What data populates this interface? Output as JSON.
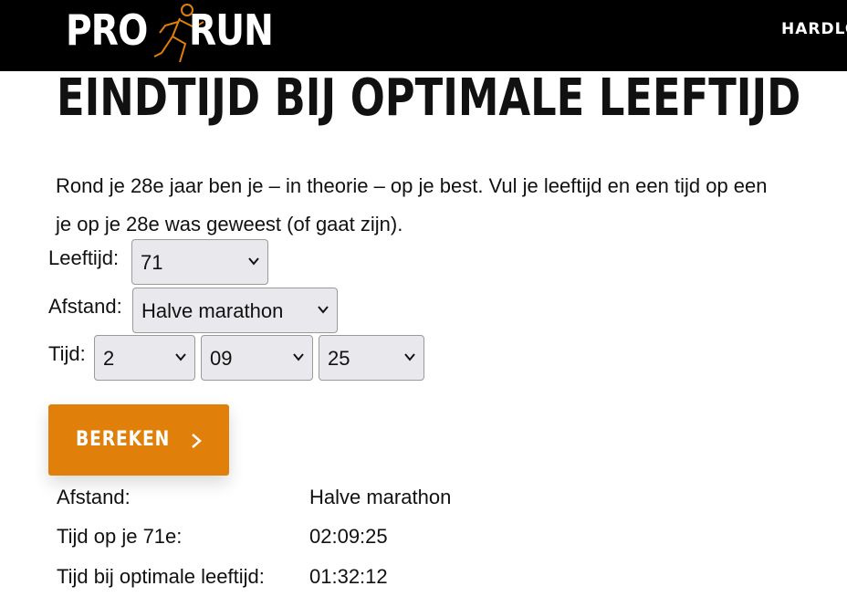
{
  "header": {
    "logo_left": "PRO",
    "logo_right": "RUN",
    "nav_link": "HARDLO"
  },
  "page": {
    "title": "Eindtijd bij optimale leeftijd",
    "intro_line1": "Rond je 28e jaar ben je – in theorie – op je best. Vul je leeftijd en een tijd op een",
    "intro_line2": "je op je 28e was geweest (of gaat zijn)."
  },
  "form": {
    "age_label": "Leeftijd:",
    "age_value": "71",
    "distance_label": "Afstand:",
    "distance_value": "Halve marathon",
    "time_label": "Tijd:",
    "hours_value": "2",
    "minutes_value": "09",
    "seconds_value": "25",
    "submit_label": "BEREKEN"
  },
  "results": {
    "distance_label": "Afstand:",
    "distance_value": "Halve marathon",
    "time_at_age_label": "Tijd op je 71e:",
    "time_at_age_value": "02:09:25",
    "optimal_label": "Tijd bij optimale leeftijd:",
    "optimal_value": "01:32:12"
  },
  "colors": {
    "accent": "#e07f0a",
    "header_bg": "#000000",
    "select_bg": "#e9e9ed"
  },
  "icons": {
    "select_arrow": "chevron-down-icon",
    "button_arrow": "chevron-right-icon",
    "logo_figure": "runner-icon"
  }
}
